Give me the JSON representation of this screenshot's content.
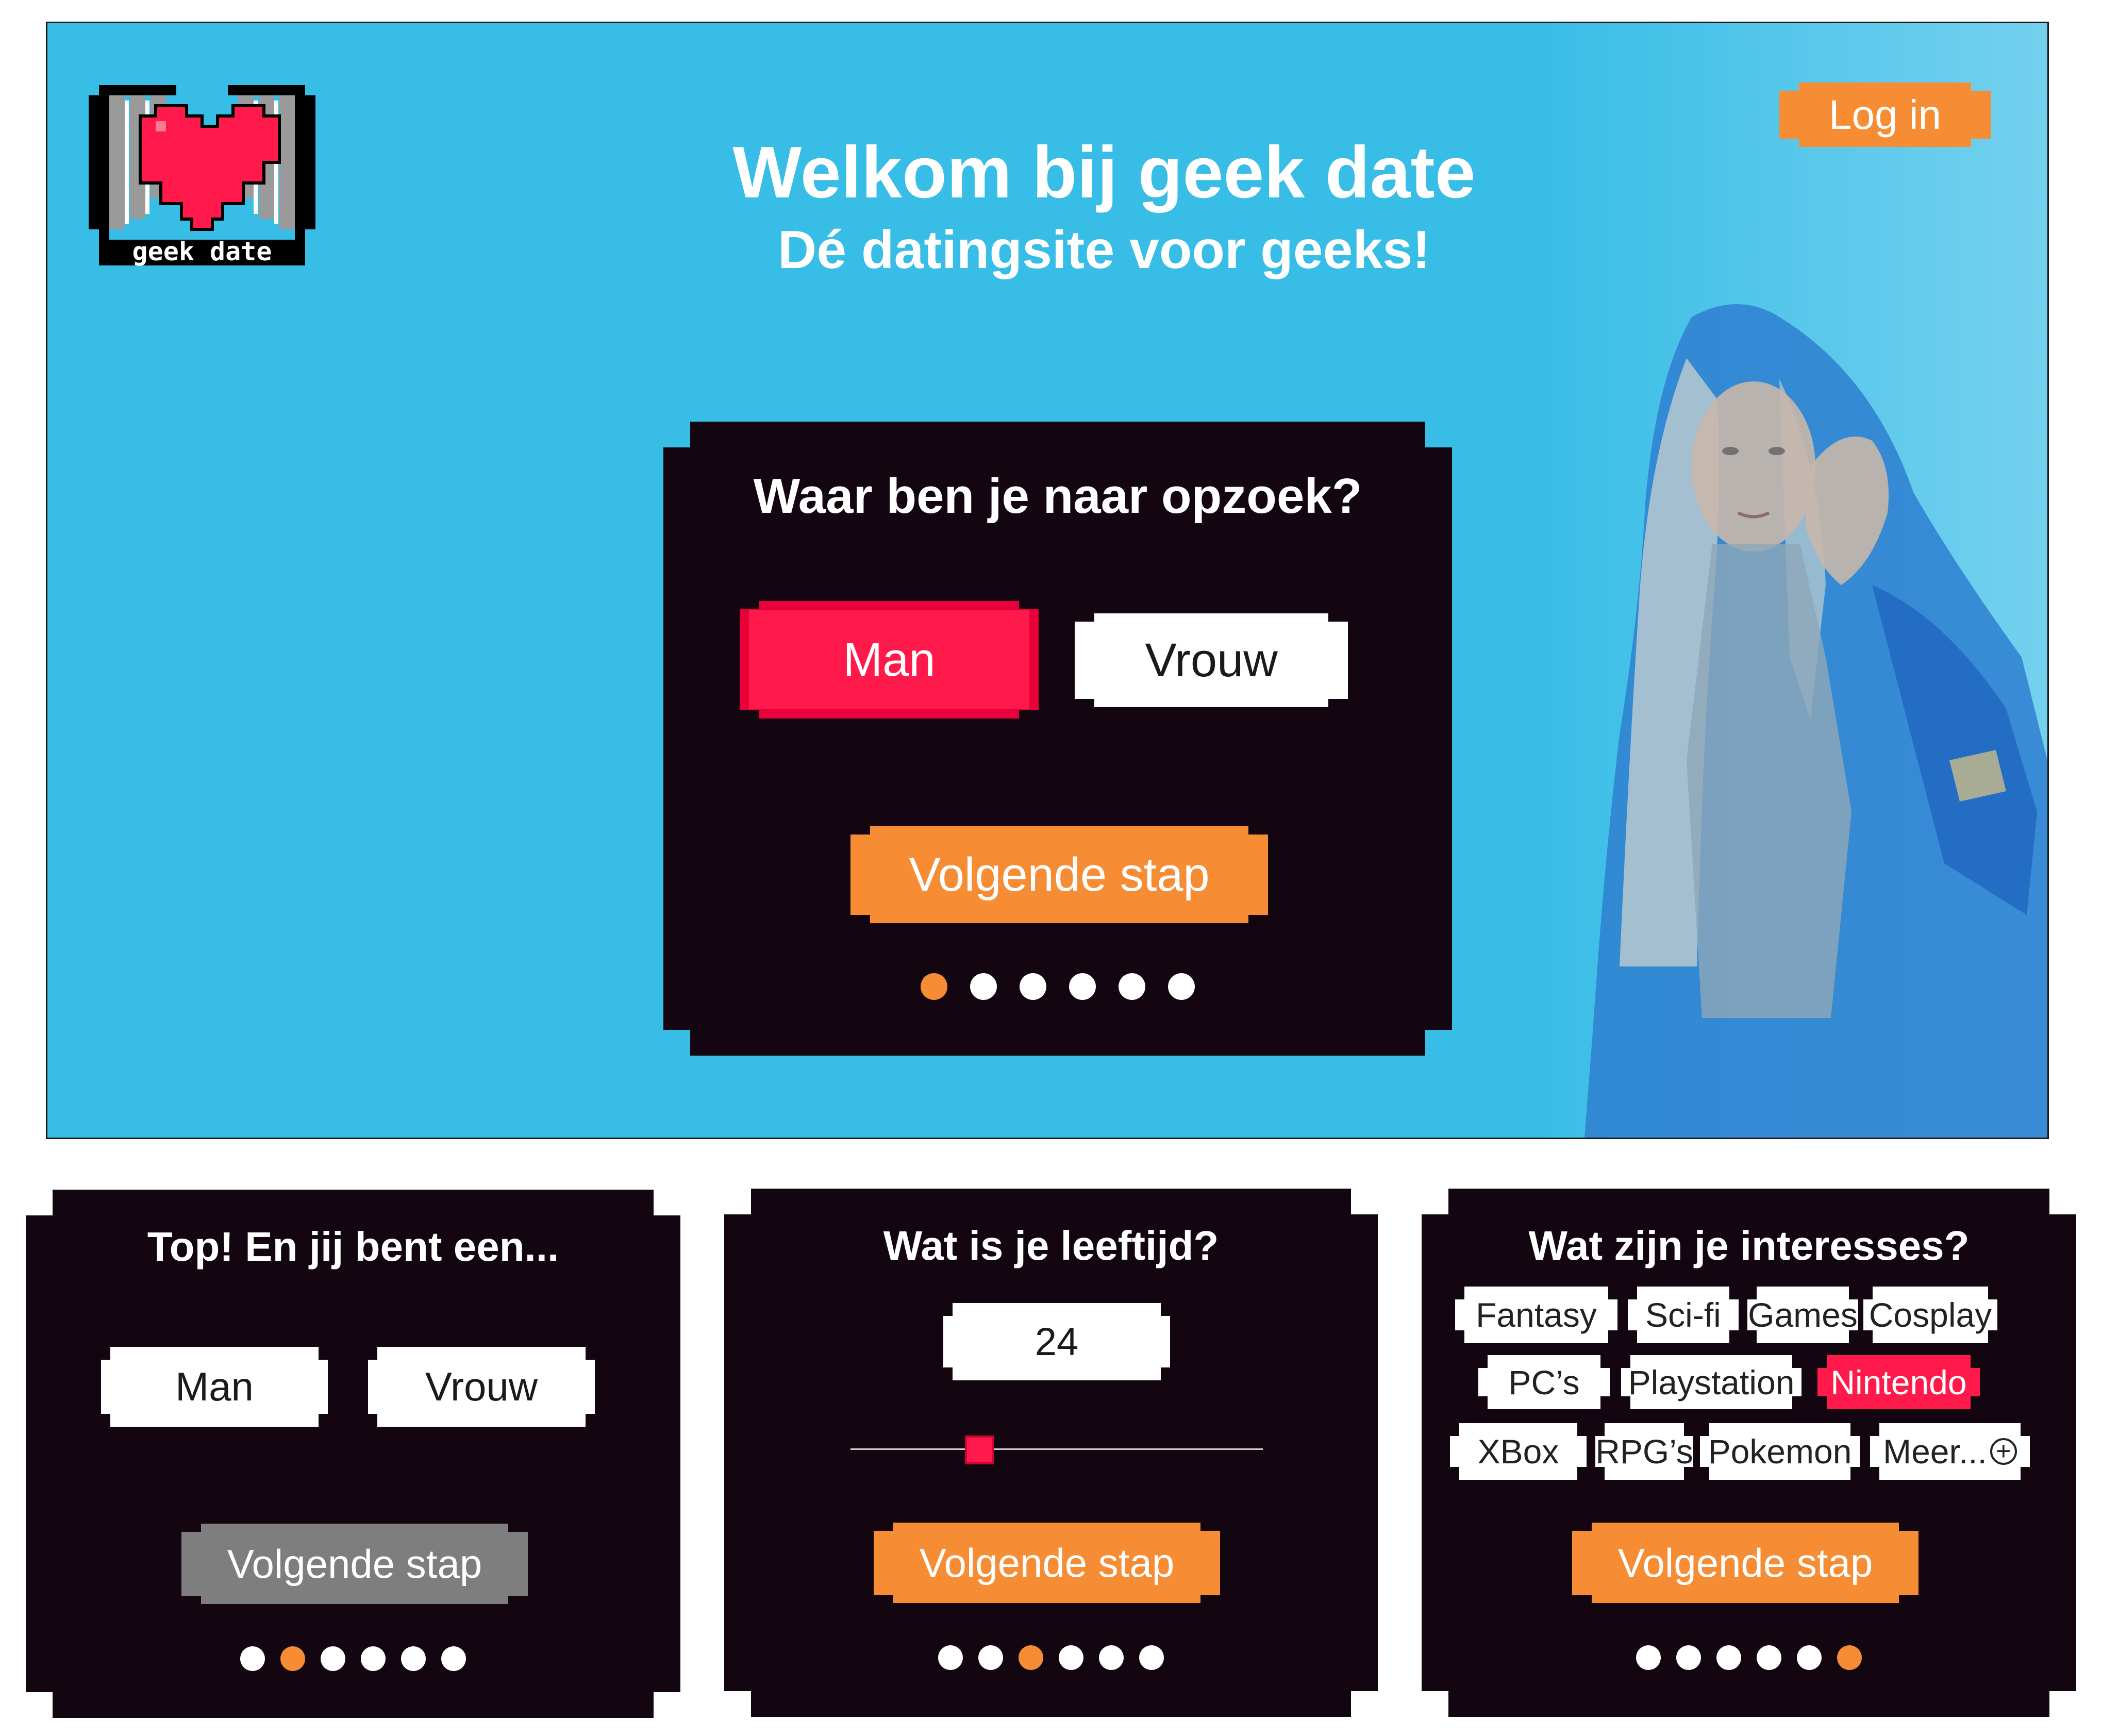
{
  "colors": {
    "hero_bg": "#38bde7",
    "card_bg": "#130610",
    "accent_orange": "#f68d34",
    "accent_red": "#ff1a4b",
    "disabled_grey": "#7e7e7e"
  },
  "hero": {
    "logo_text": "geek date",
    "title": "Welkom bij geek date",
    "subtitle": "Dé datingsite voor geeks!",
    "login_label": "Log in"
  },
  "step1": {
    "title": "Waar ben je naar opzoek?",
    "options": [
      "Man",
      "Vrouw"
    ],
    "selected": "Man",
    "next_label": "Volgende stap",
    "progress": {
      "current": 1,
      "total": 6
    }
  },
  "step2": {
    "title": "Top! En jij bent een...",
    "options": [
      "Man",
      "Vrouw"
    ],
    "next_label": "Volgende stap",
    "next_enabled": false,
    "progress": {
      "current": 2,
      "total": 6
    }
  },
  "step3": {
    "title": "Wat is je leeftijd?",
    "age_value": "24",
    "next_label": "Volgende stap",
    "progress": {
      "current": 3,
      "total": 6
    }
  },
  "step4": {
    "title": "Wat zijn je interesses?",
    "interests": [
      "Fantasy",
      "Sci-fi",
      "Games",
      "Cosplay",
      "PC’s",
      "Playstation",
      "Nintendo",
      "XBox",
      "RPG’s",
      "Pokemon",
      "Meer..."
    ],
    "selected": "Nintendo",
    "more_icon": "plus-circle-icon",
    "next_label": "Volgende stap",
    "progress": {
      "current": 6,
      "total": 6
    }
  }
}
